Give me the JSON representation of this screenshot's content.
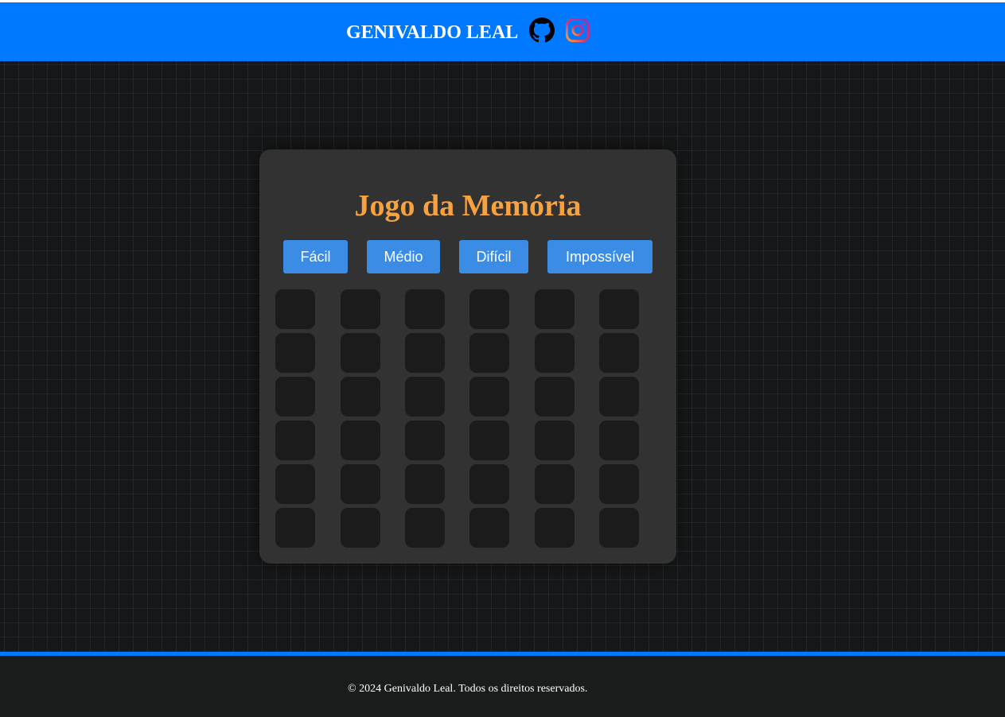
{
  "header": {
    "brand": "GENIVALDO LEAL",
    "icons": [
      "github-icon",
      "instagram-icon"
    ],
    "background_color": "#0078ff"
  },
  "game": {
    "title": "Jogo da Memória",
    "difficulty_buttons": [
      {
        "label": "Fácil"
      },
      {
        "label": "Médio"
      },
      {
        "label": "Difícil"
      },
      {
        "label": "Impossível"
      }
    ],
    "board": {
      "rows": 6,
      "columns": 6,
      "face_down_cards": 36
    },
    "colors": {
      "title": "#f7a23f",
      "button": "#3a8ce4",
      "panel": "#323232",
      "card": "#1b1b1b"
    }
  },
  "footer": {
    "copyright": "© 2024 Genivaldo Leal. Todos os direitos reservados."
  }
}
